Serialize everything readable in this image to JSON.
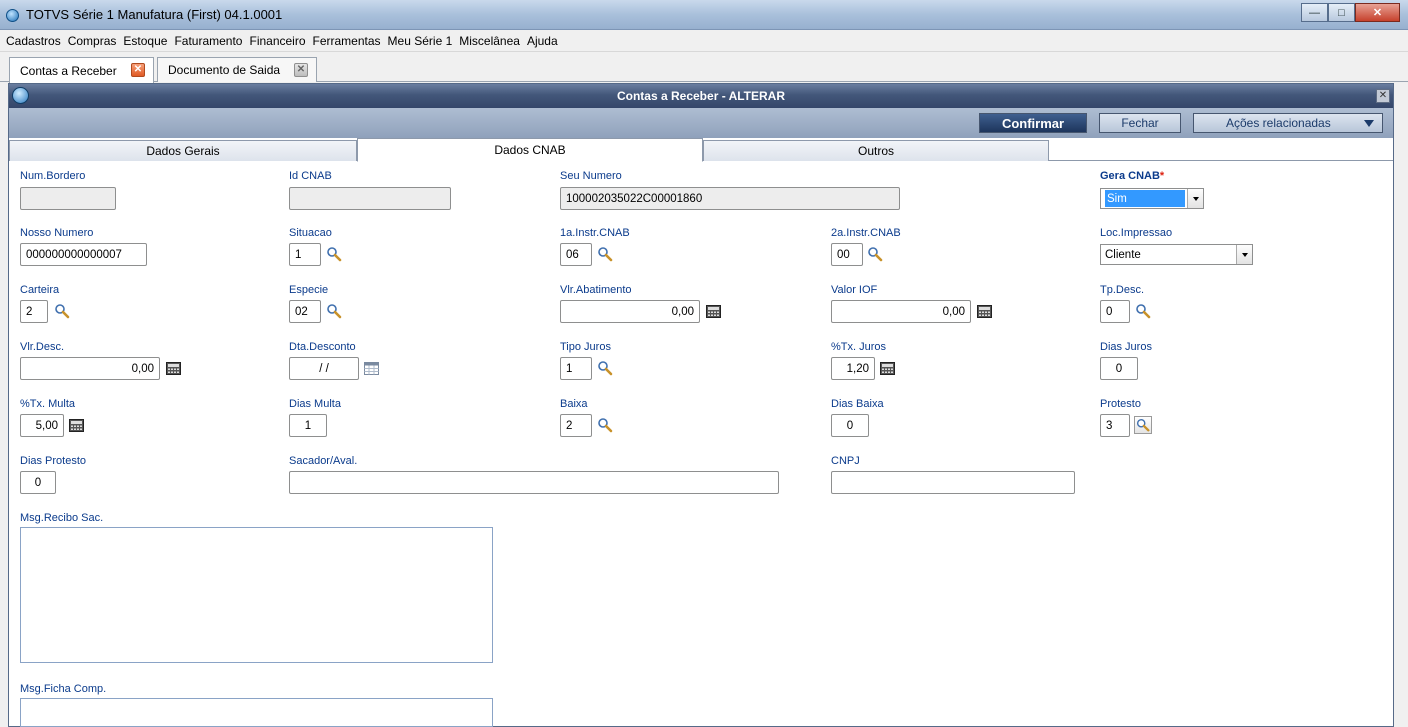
{
  "window": {
    "title": "TOTVS Série 1 Manufatura (First) 04.1.0001",
    "buttons": [
      "minimize",
      "maximize",
      "close"
    ]
  },
  "menu": [
    "Cadastros",
    "Compras",
    "Estoque",
    "Faturamento",
    "Financeiro",
    "Ferramentas",
    "Meu Série 1",
    "Miscelânea",
    "Ajuda"
  ],
  "doc_tabs": [
    {
      "label": "Contas a Receber",
      "active": true
    },
    {
      "label": "Documento de Saida",
      "active": false
    }
  ],
  "dialog": {
    "title": "Contas a Receber - ALTERAR",
    "confirm": "Confirmar",
    "close": "Fechar",
    "actions": "Ações relacionadas"
  },
  "form_tabs": [
    "Dados Gerais",
    "Dados CNAB",
    "Outros"
  ],
  "fields": {
    "num_bordero": {
      "label": "Num.Bordero",
      "value": ""
    },
    "id_cnab": {
      "label": "Id CNAB",
      "value": ""
    },
    "seu_numero": {
      "label": "Seu Numero",
      "value": "100002035022C00001860"
    },
    "gera_cnab": {
      "label": "Gera CNAB",
      "required_mark": "*",
      "value": "Sim"
    },
    "nosso_numero": {
      "label": "Nosso Numero",
      "value": "000000000000007"
    },
    "situacao": {
      "label": "Situacao",
      "value": "1"
    },
    "instr1": {
      "label": "1a.Instr.CNAB",
      "value": "06"
    },
    "instr2": {
      "label": "2a.Instr.CNAB",
      "value": "00"
    },
    "loc_impressao": {
      "label": "Loc.Impressao",
      "value": "Cliente"
    },
    "carteira": {
      "label": "Carteira",
      "value": "2"
    },
    "especie": {
      "label": "Especie",
      "value": "02"
    },
    "vlr_abatimento": {
      "label": "Vlr.Abatimento",
      "value": "0,00"
    },
    "valor_iof": {
      "label": "Valor IOF",
      "value": "0,00"
    },
    "tp_desc": {
      "label": "Tp.Desc.",
      "value": "0"
    },
    "vlr_desc": {
      "label": "Vlr.Desc.",
      "value": "0,00"
    },
    "dta_desconto": {
      "label": "Dta.Desconto",
      "value": "/ /"
    },
    "tipo_juros": {
      "label": "Tipo Juros",
      "value": "1"
    },
    "tx_juros": {
      "label": "%Tx. Juros",
      "value": "1,20"
    },
    "dias_juros": {
      "label": "Dias Juros",
      "value": "0"
    },
    "tx_multa": {
      "label": "%Tx. Multa",
      "value": "5,00"
    },
    "dias_multa": {
      "label": "Dias Multa",
      "value": "1"
    },
    "baixa": {
      "label": "Baixa",
      "value": "2"
    },
    "dias_baixa": {
      "label": "Dias Baixa",
      "value": "0"
    },
    "protesto": {
      "label": "Protesto",
      "value": "3"
    },
    "dias_protesto": {
      "label": "Dias Protesto",
      "value": "0"
    },
    "sacador": {
      "label": "Sacador/Aval.",
      "value": ""
    },
    "cnpj": {
      "label": "CNPJ",
      "value": ""
    },
    "msg_recibo": {
      "label": "Msg.Recibo Sac.",
      "value": ""
    },
    "msg_ficha": {
      "label": "Msg.Ficha Comp.",
      "value": ""
    }
  },
  "colors": {
    "label": "#0b3b8c",
    "header_dark": "#34466a",
    "select_highlight": "#3399ff"
  }
}
